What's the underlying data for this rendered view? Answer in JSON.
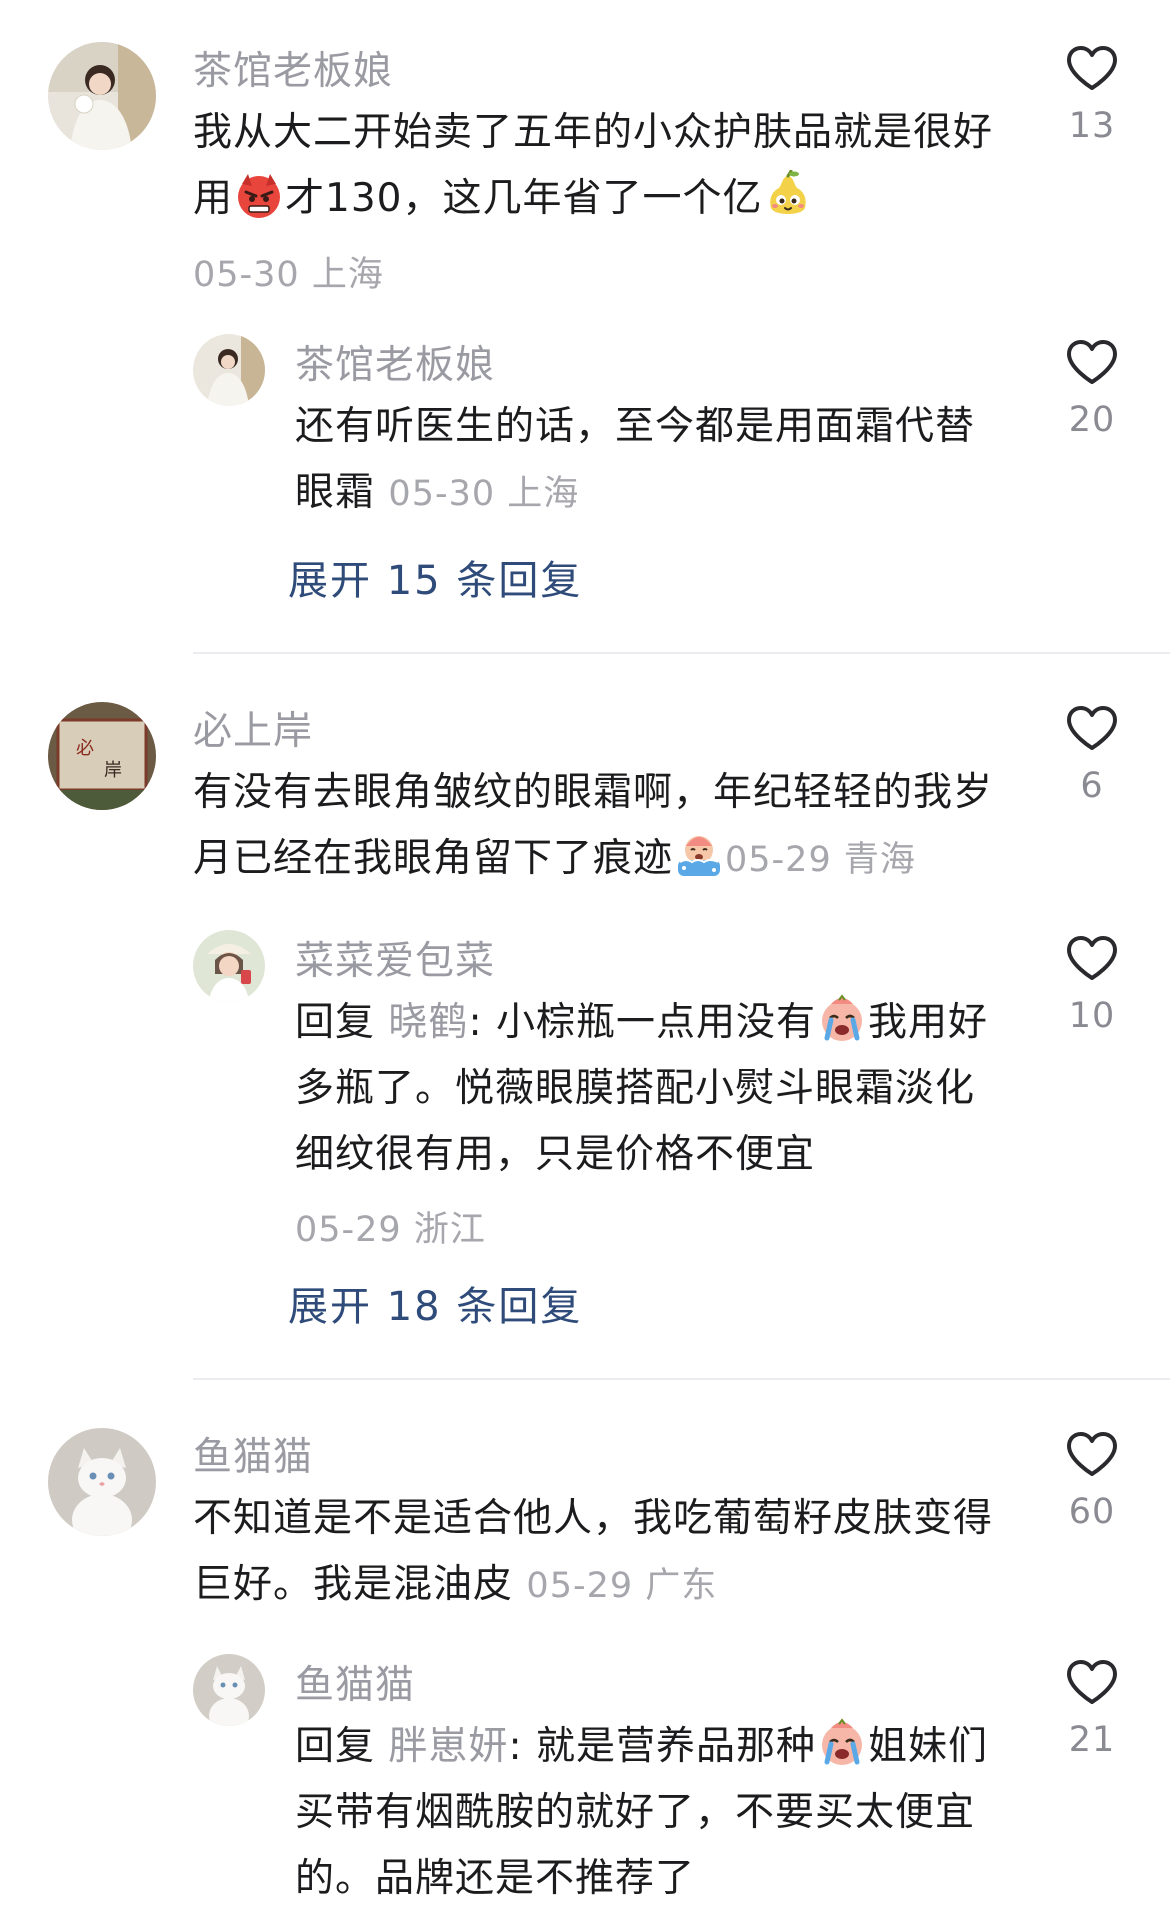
{
  "comments": [
    {
      "username": "茶馆老板娘",
      "text_parts": [
        "我从大二开始卖了五年的小众护肤品就是很好用",
        "才130，这几年省了一个亿"
      ],
      "emojis": [
        "angry-face-emoji",
        "pear-face-emoji"
      ],
      "meta": "05-30 上海",
      "likes": "13",
      "replies": [
        {
          "username": "茶馆老板娘",
          "text": "还有听医生的话，至今都是用面霜代替眼霜",
          "meta": "05-30 上海",
          "likes": "20"
        }
      ],
      "expand_label": "展开 15 条回复"
    },
    {
      "username": "必上岸",
      "text": "有没有去眼角皱纹的眼霜啊，年纪轻轻的我岁月已经在我眼角留下了痕迹",
      "emojis": [
        "bathing-crying-emoji"
      ],
      "meta": "05-29 青海",
      "likes": "6",
      "replies": [
        {
          "username": "菜菜爱包菜",
          "reply_prefix": "回复",
          "reply_to": "晓鹤",
          "text_parts": [
            ": 小棕瓶一点用没有",
            "我用好多瓶了。悦薇眼膜搭配小熨斗眼霜淡化细纹很有用，只是价格不便宜"
          ],
          "emojis": [
            "loudly-crying-emoji"
          ],
          "meta": "05-29 浙江",
          "likes": "10"
        }
      ],
      "expand_label": "展开 18 条回复"
    },
    {
      "username": "鱼猫猫",
      "text": "不知道是不是适合他人，我吃葡萄籽皮肤变得巨好。我是混油皮",
      "meta": "05-29 广东",
      "likes": "60",
      "replies": [
        {
          "username": "鱼猫猫",
          "reply_prefix": "回复",
          "reply_to": "胖崽妍",
          "text_parts": [
            ": 就是营养品那种",
            "姐妹们买带有烟酰胺的就好了，不要买太便宜的。品牌还是不推荐了"
          ],
          "emojis": [
            "loudly-crying-emoji"
          ],
          "likes": "21"
        }
      ]
    }
  ],
  "colors": {
    "username": "#9a9aa2",
    "body_text": "#1c1c1e",
    "meta": "#a6a6ad",
    "expand_link": "#2f4b7a",
    "divider": "#ececf0"
  }
}
